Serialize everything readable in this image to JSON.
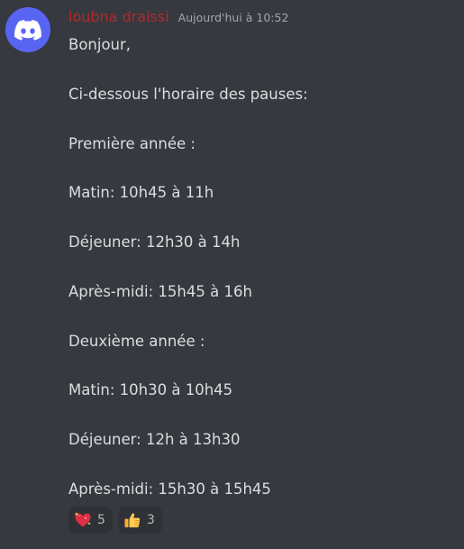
{
  "message": {
    "author": "loubna draissi",
    "timestamp": "Aujourd'hui à 10:52",
    "lines": [
      "Bonjour,",
      "",
      "Ci-dessous l'horaire des pauses:",
      "",
      "Première année :",
      "",
      "Matin: 10h45 à 11h",
      "",
      "Déjeuner: 12h30 à 14h",
      "",
      "Après-midi: 15h45 à 16h",
      "",
      "Deuxième année :",
      "",
      "Matin: 10h30 à 10h45",
      "",
      "Déjeuner: 12h à 13h30",
      "",
      "Après-midi: 15h30 à 15h45"
    ]
  },
  "reactions": [
    {
      "emoji": "sparkling-heart-icon",
      "count": "5"
    },
    {
      "emoji": "thumbs-up-icon",
      "count": "3"
    }
  ],
  "colors": {
    "background": "#36393f",
    "avatar": "#5865f2",
    "username": "#b3282c",
    "text": "#dcddde",
    "reaction_bg": "#2f3136"
  }
}
